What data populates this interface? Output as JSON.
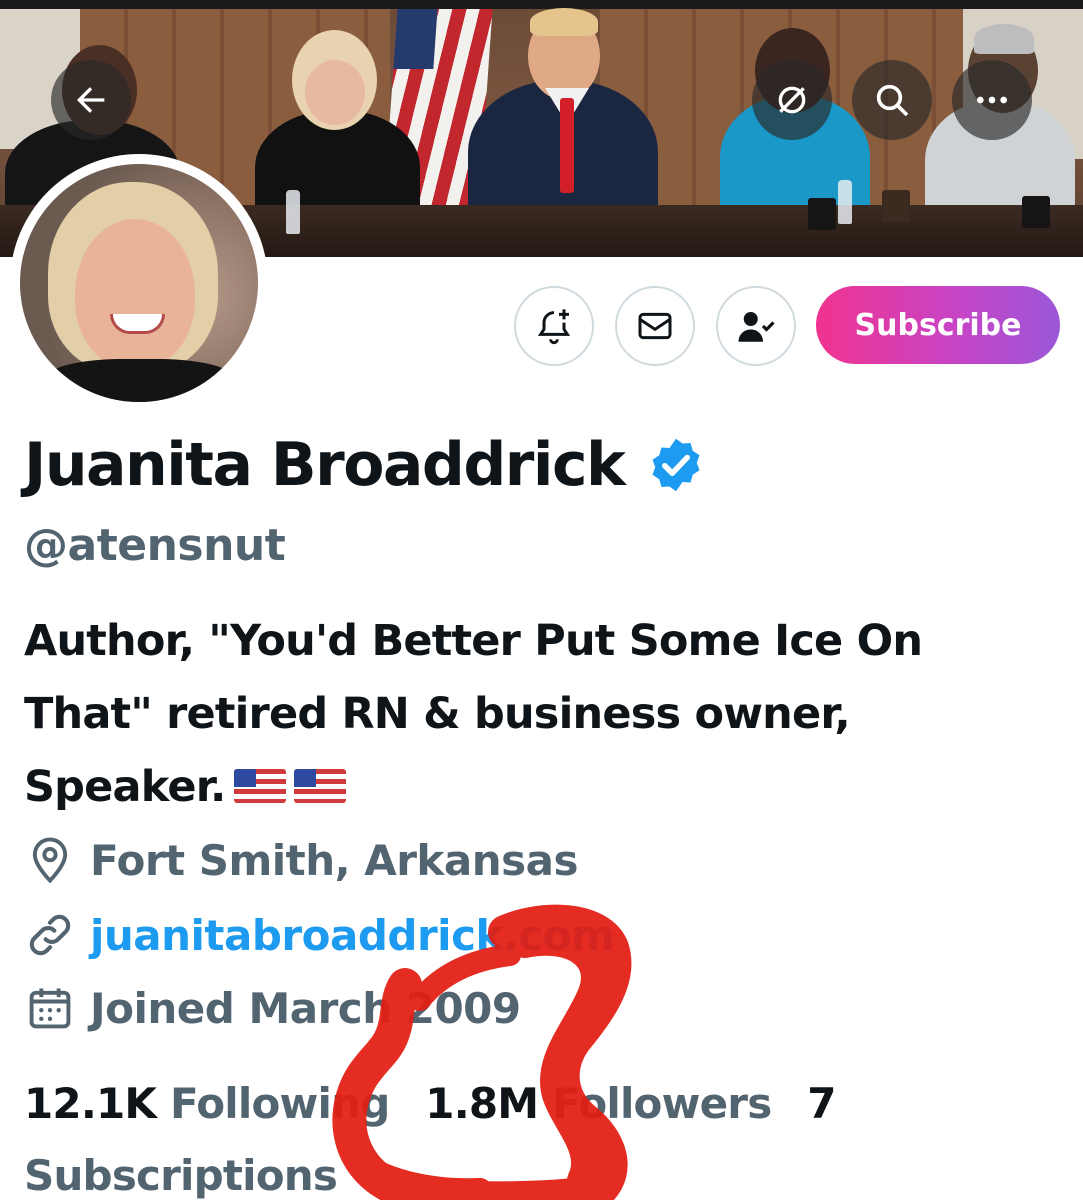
{
  "header": {
    "back_icon": "arrow-left-icon",
    "hide_icon": "slashed-circle-icon",
    "search_icon": "search-icon",
    "more_icon": "more-dots-icon"
  },
  "actions": {
    "notify_icon": "bell-plus-icon",
    "message_icon": "envelope-icon",
    "following_icon": "person-check-icon",
    "subscribe_label": "Subscribe"
  },
  "profile": {
    "name": "Juanita Broaddrick",
    "handle": "@atensnut",
    "bio": "Author, \"You'd Better Put Some Ice On That\" retired RN & business owner, Speaker.",
    "location": "Fort Smith, Arkansas",
    "website": "juanitabroaddrick.com",
    "joined": "Joined March 2009"
  },
  "stats": {
    "following_count": "12.1K",
    "following_label": "Following",
    "followers_count": "1.8M",
    "followers_label": "Followers",
    "subscriptions_count": "7",
    "subscriptions_label": "Subscriptions"
  },
  "colors": {
    "verified": "#1d9bf0",
    "link": "#1d9bf0",
    "muted": "#536471",
    "subscribe_start": "#f0338f",
    "subscribe_end": "#9a57d8",
    "scribble": "#e31d12"
  }
}
